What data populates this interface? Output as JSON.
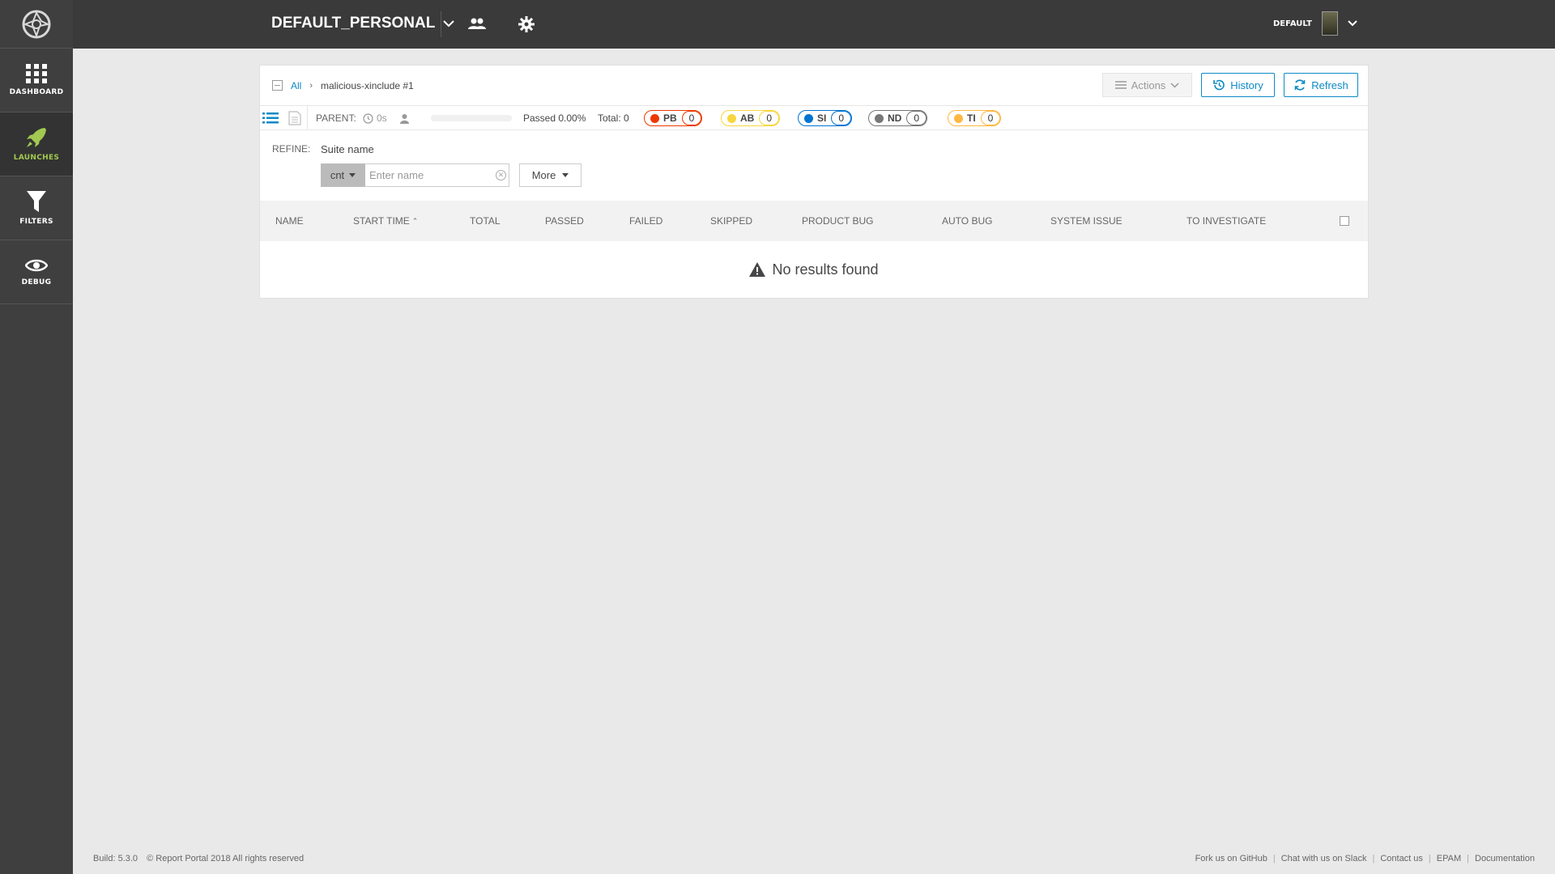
{
  "sidebar": {
    "items": [
      {
        "label": "DASHBOARD",
        "icon": "dashboard-grid-icon"
      },
      {
        "label": "LAUNCHES",
        "icon": "rocket-icon"
      },
      {
        "label": "FILTERS",
        "icon": "filter-icon"
      },
      {
        "label": "DEBUG",
        "icon": "eye-icon"
      }
    ]
  },
  "header": {
    "project_name": "DEFAULT_PERSONAL",
    "user_name": "DEFAULT"
  },
  "breadcrumb": {
    "all": "All",
    "current": "malicious-xinclude #1"
  },
  "toolbar": {
    "actions": "Actions",
    "history": "History",
    "refresh": "Refresh"
  },
  "info": {
    "parent_label": "PARENT:",
    "duration": "0s",
    "passed": "Passed 0.00%",
    "total": "Total: 0",
    "progress": 0,
    "defects": [
      {
        "name": "PB",
        "count": "0",
        "color": "#ec3900",
        "border": "#ec3900"
      },
      {
        "name": "AB",
        "count": "0",
        "color": "#f7d63e",
        "border": "#f7d63e"
      },
      {
        "name": "SI",
        "count": "0",
        "color": "#0274d1",
        "border": "#0274d1"
      },
      {
        "name": "ND",
        "count": "0",
        "color": "#777777",
        "border": "#777777"
      },
      {
        "name": "TI",
        "count": "0",
        "color": "#ffb743",
        "border": "#ffb743"
      }
    ]
  },
  "refine": {
    "label": "REFINE:",
    "field_name": "Suite name",
    "condition": "cnt",
    "placeholder": "Enter name",
    "more": "More"
  },
  "table": {
    "columns": [
      "NAME",
      "START TIME",
      "TOTAL",
      "PASSED",
      "FAILED",
      "SKIPPED",
      "PRODUCT BUG",
      "AUTO BUG",
      "SYSTEM ISSUE",
      "TO INVESTIGATE"
    ],
    "empty_message": "No results found"
  },
  "footer": {
    "build": "Build: 5.3.0",
    "copyright": "© Report Portal 2018 All rights reserved",
    "links": [
      "Fork us on GitHub",
      "Chat with us on Slack",
      "Contact us",
      "EPAM",
      "Documentation"
    ]
  },
  "colors": {
    "accent": "#0c8ac5",
    "launches_active": "#a2c951",
    "sidebar_bg": "#3f3f3f",
    "header_bg": "#3a3a3a"
  }
}
